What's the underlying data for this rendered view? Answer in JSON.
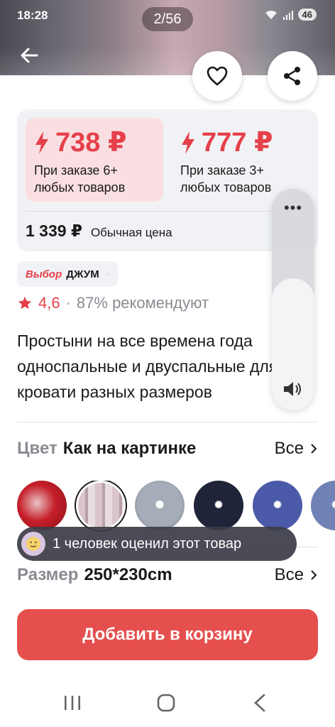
{
  "status_bar": {
    "time": "18:28",
    "battery": "46"
  },
  "gallery": {
    "counter": "2/56"
  },
  "price_card": {
    "tiers": [
      {
        "price": "738 ₽",
        "condition": "При заказе 6+ любых товаров"
      },
      {
        "price": "777 ₽",
        "condition": "При заказе 3+ любых товаров"
      }
    ],
    "regular_price": "1 339 ₽",
    "regular_label": "Обычная цена"
  },
  "brand": {
    "prefix": "Выбор",
    "name": "ДЖУМ"
  },
  "rating": {
    "value": "4,6",
    "separator": "·",
    "recommend": "87% рекомендуют"
  },
  "product": {
    "title": "Простыни на все времена года односпальные и двуспальные для кровати разных размеров"
  },
  "color": {
    "label": "Цвет",
    "value": "Как на картинке",
    "all": "Все",
    "selected_index": 1
  },
  "size": {
    "label": "Размер",
    "value": "250*230cm",
    "all": "Все"
  },
  "toast": {
    "text": "1 человек оценил этот товар"
  },
  "cta": {
    "add_to_cart": "Добавить в корзину"
  },
  "colors": {
    "accent": "#e5404a",
    "button": "#e5504f",
    "card_bg": "#f1f2f5"
  },
  "icons": [
    "back-arrow-icon",
    "heart-icon",
    "share-icon",
    "lightning-icon",
    "star-icon",
    "chevron-right-icon",
    "speaker-icon",
    "more-dots-icon"
  ]
}
